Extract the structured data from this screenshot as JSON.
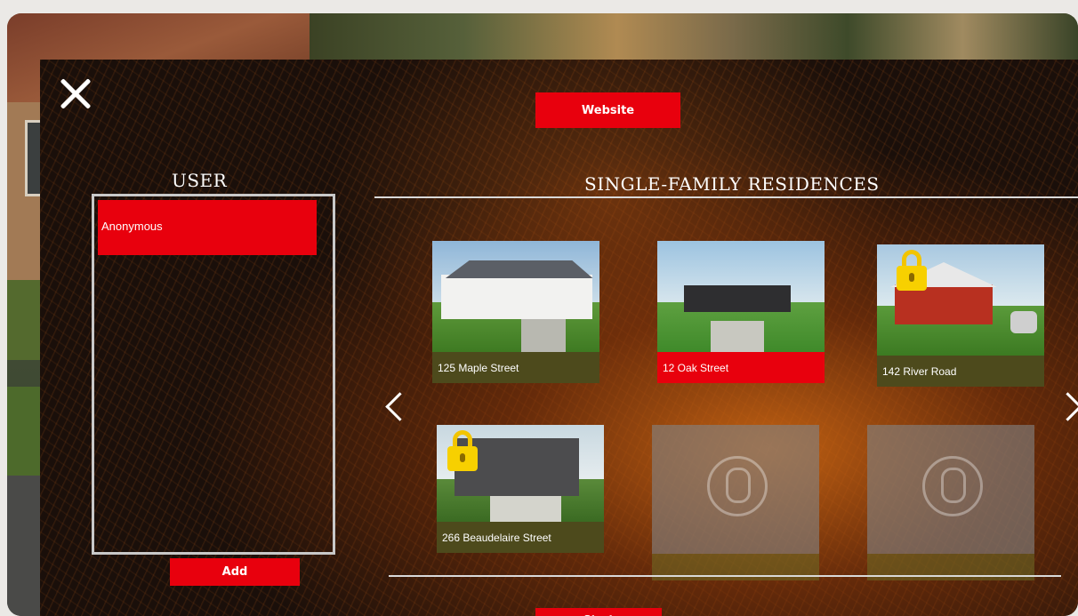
{
  "header": {
    "website_label": "Website"
  },
  "user_panel": {
    "title": "USER",
    "users": [
      "Anonymous"
    ],
    "add_label": "Add"
  },
  "main": {
    "title": "SINGLE-FAMILY RESIDENCES",
    "residences": [
      {
        "name": "125 Maple Street",
        "locked": false,
        "selected": false
      },
      {
        "name": "12 Oak Street",
        "locked": false,
        "selected": true
      },
      {
        "name": "142 River Road",
        "locked": true,
        "selected": false
      },
      {
        "name": "266 Beaudelaire Street",
        "locked": true,
        "selected": false
      }
    ],
    "start_label": "Start"
  },
  "colors": {
    "accent": "#e8000d",
    "lock": "#f7d000"
  }
}
